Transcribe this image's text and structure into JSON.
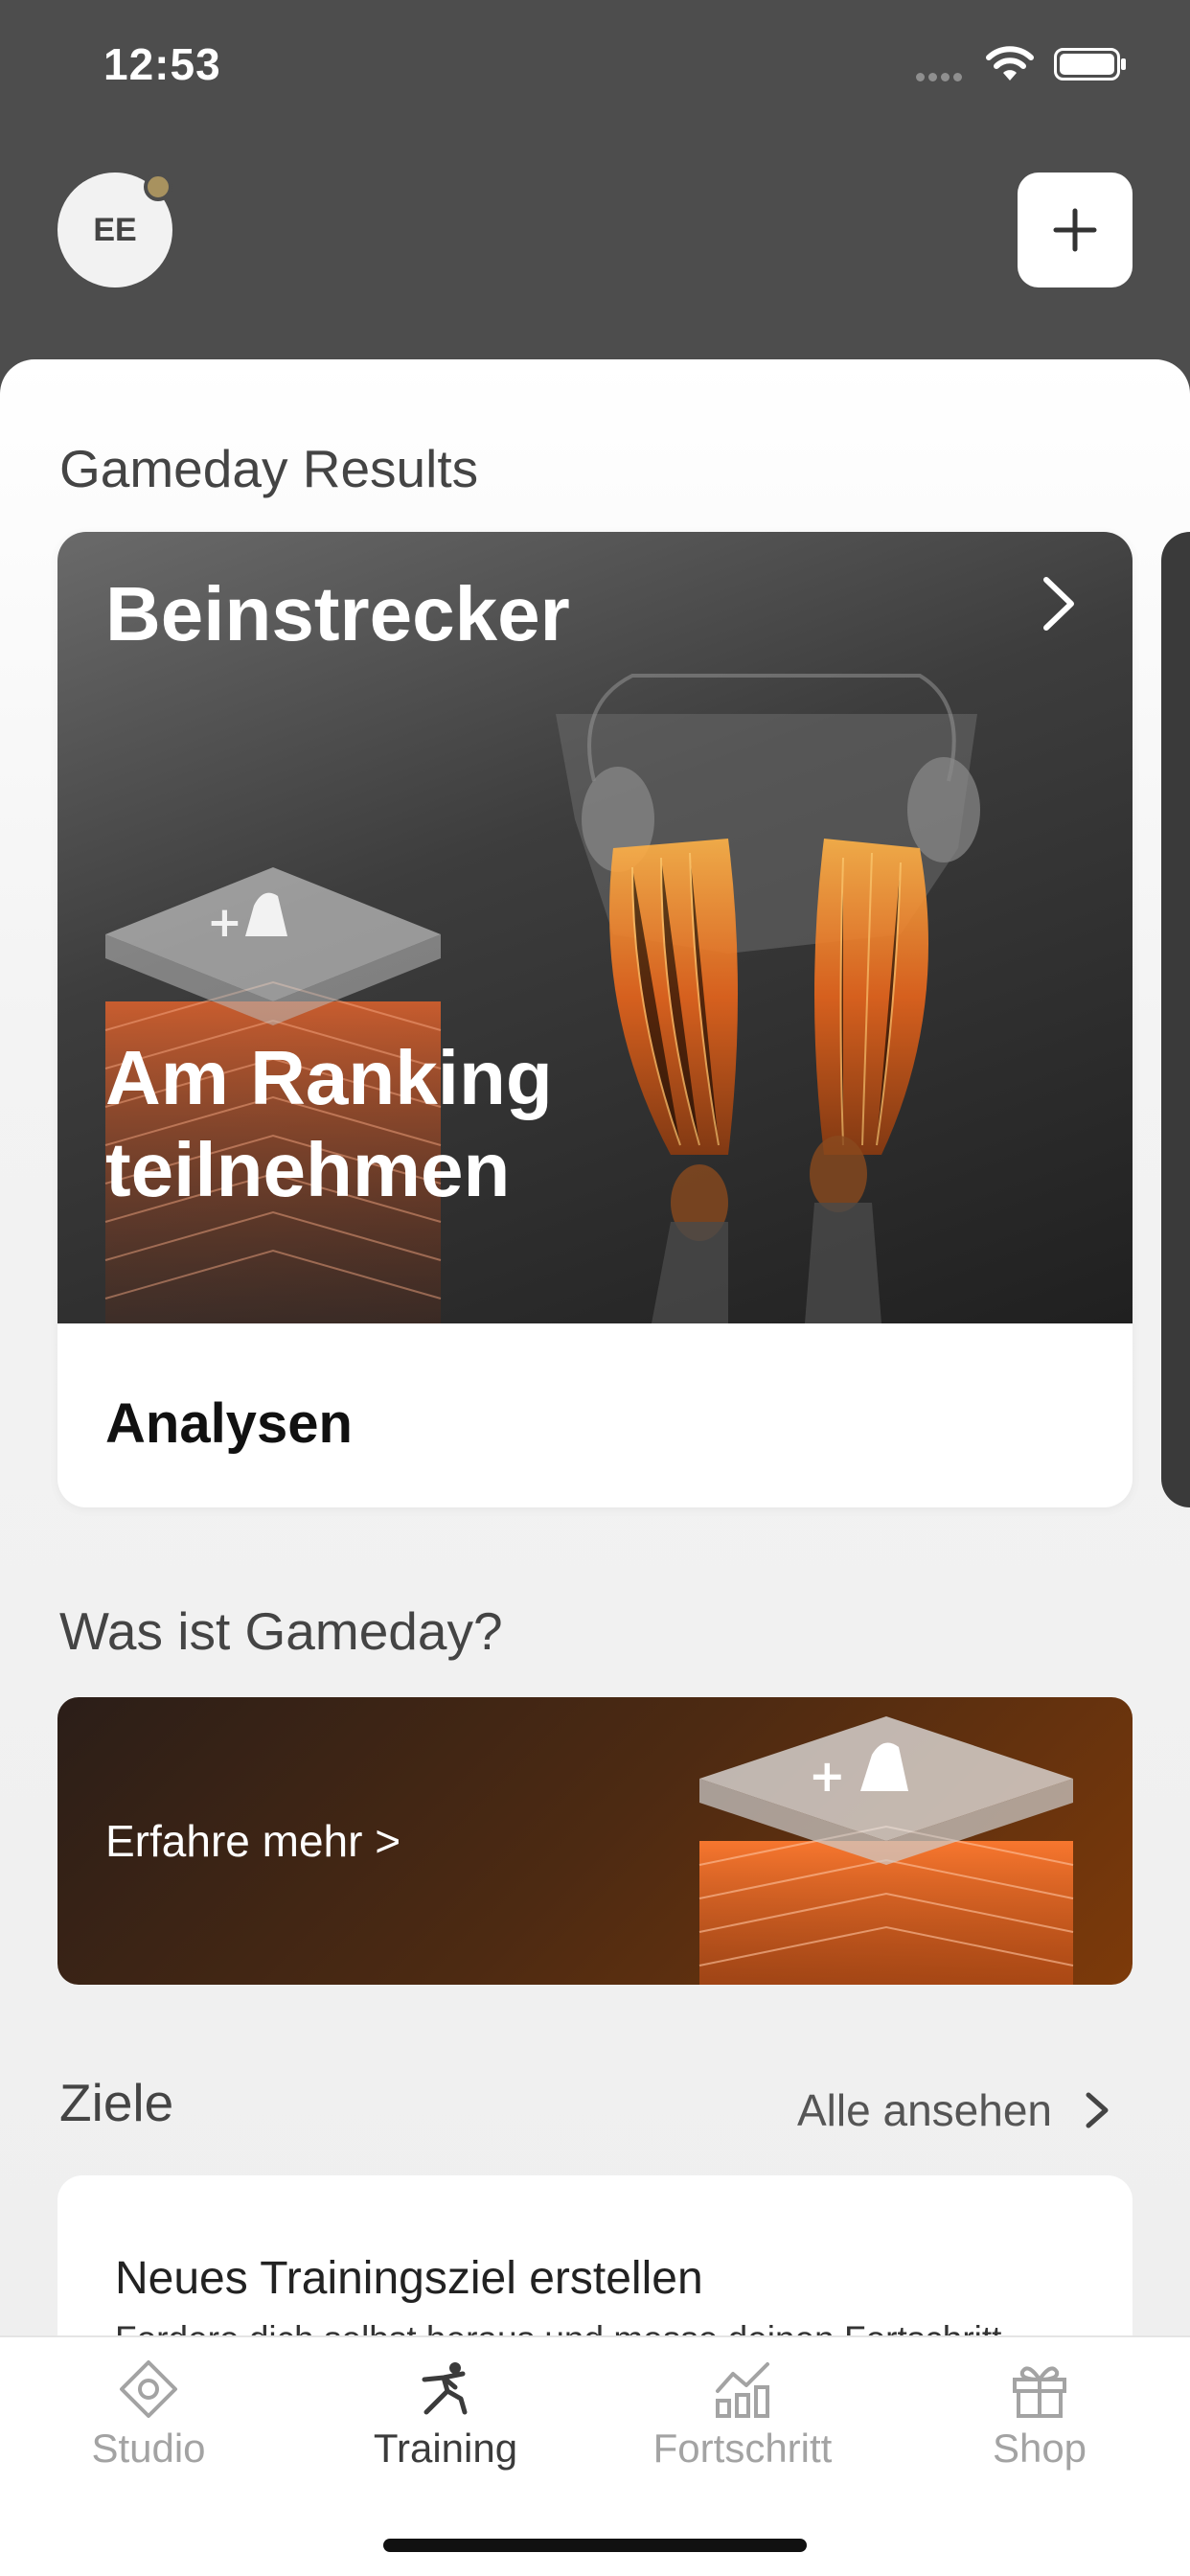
{
  "status_bar": {
    "time": "12:53"
  },
  "header": {
    "avatar_initials": "EE"
  },
  "gameday_results": {
    "section_title": "Gameday Results",
    "card": {
      "title": "Beinstrecker",
      "cta": "Am Ranking teilnehmen",
      "footer": "Analysen"
    }
  },
  "what_is_gameday": {
    "section_title": "Was ist Gameday?",
    "banner_text": "Erfahre mehr >"
  },
  "goals": {
    "section_title": "Ziele",
    "see_all": "Alle ansehen",
    "card": {
      "title": "Neues Trainingsziel erstellen",
      "subtitle": "Fordere dich selbst heraus und messe deinen Fortschritt"
    }
  },
  "tabbar": {
    "tabs": [
      {
        "label": "Studio",
        "icon": "studio-icon"
      },
      {
        "label": "Training",
        "icon": "training-icon"
      },
      {
        "label": "Fortschritt",
        "icon": "progress-chart-icon"
      },
      {
        "label": "Shop",
        "icon": "gift-icon"
      }
    ],
    "active_tab": "Training"
  },
  "colors": {
    "header_bg": "#4d4d4d",
    "avatar_badge": "#a8925f",
    "banner_accent": "#e8651c"
  }
}
